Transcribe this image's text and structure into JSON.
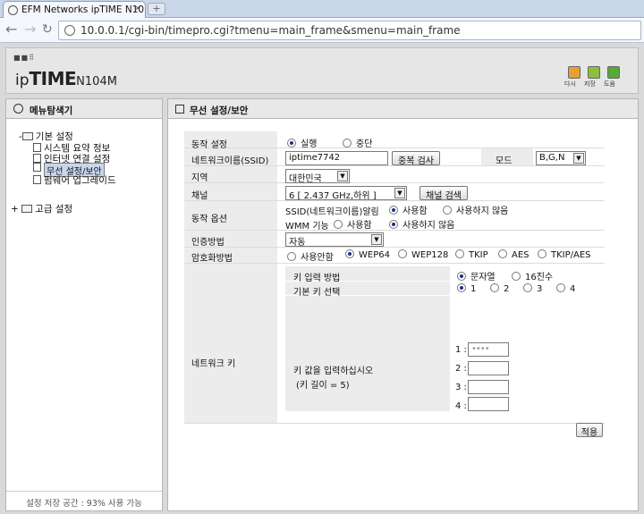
{
  "browser": {
    "tab_title": "EFM Networks ipTIME N10",
    "url": "10.0.0.1/cgi-bin/timepro.cgi?tmenu=main_frame&smenu=main_frame"
  },
  "header": {
    "logo_prefix": "ip",
    "logo_mid": "TIME",
    "logo_model": "N104M",
    "buttons": [
      {
        "label": "다시",
        "icon": "refresh-icon",
        "color": "#e8a030"
      },
      {
        "label": "저장",
        "icon": "save-icon",
        "color": "#8cbf3a"
      },
      {
        "label": "도움",
        "icon": "help-icon",
        "color": "#5aa83a"
      }
    ]
  },
  "sidebar": {
    "title": "메뉴탐색기",
    "basic": {
      "label": "기본 설정",
      "toggle": "-"
    },
    "items": [
      {
        "label": "시스템 요약 정보"
      },
      {
        "label": "인터넷 연결 설정"
      },
      {
        "label": "무선 설정/보안"
      },
      {
        "label": "펌웨어 업그레이드"
      }
    ],
    "advanced": {
      "label": "고급 설정",
      "toggle": "+"
    },
    "usage": "설정 저장 공간 : 93% 사용 가능"
  },
  "main": {
    "title": "무선 설정/보안",
    "operation": {
      "label": "동작 설정",
      "options": [
        "실행",
        "중단"
      ],
      "selected": 0
    },
    "ssid": {
      "label": "네트워크이름(SSID)",
      "value": "iptime7742",
      "dup_button": "중복 검사"
    },
    "mode": {
      "label": "모드",
      "value": "B,G,N"
    },
    "region": {
      "label": "지역",
      "value": "대한민국"
    },
    "channel": {
      "label": "채널",
      "value": "6 [ 2.437 GHz,하위 ]",
      "search_button": "채널 검색"
    },
    "options": {
      "label": "동작 옵션",
      "ssid_broadcast": {
        "label": "SSID(네트워크이름)알림",
        "options": [
          "사용함",
          "사용하지 않음"
        ],
        "selected": 0
      },
      "wmm": {
        "label": "WMM 기능",
        "options": [
          "사용함",
          "사용하지 않음"
        ],
        "selected": 1
      }
    },
    "auth": {
      "label": "인증방법",
      "value": "자동"
    },
    "encryption": {
      "label": "암호화방법",
      "options": [
        "사용안함",
        "WEP64",
        "WEP128",
        "TKIP",
        "AES",
        "TKIP/AES"
      ],
      "selected": 1
    },
    "network_key": {
      "label": "네트워크 키",
      "input_method": {
        "label": "키 입력 방법",
        "options": [
          "문자열",
          "16진수"
        ],
        "selected": 0
      },
      "default_key": {
        "label": "기본 키 선택",
        "options": [
          "1",
          "2",
          "3",
          "4"
        ],
        "selected": 0
      },
      "prompt": "키 값을 입력하십시오",
      "length": "(키 길이 = 5)",
      "keys": [
        {
          "label": "1 :",
          "value": "••••"
        },
        {
          "label": "2 :",
          "value": ""
        },
        {
          "label": "3 :",
          "value": ""
        },
        {
          "label": "4 :",
          "value": ""
        }
      ]
    },
    "apply_button": "적용"
  }
}
